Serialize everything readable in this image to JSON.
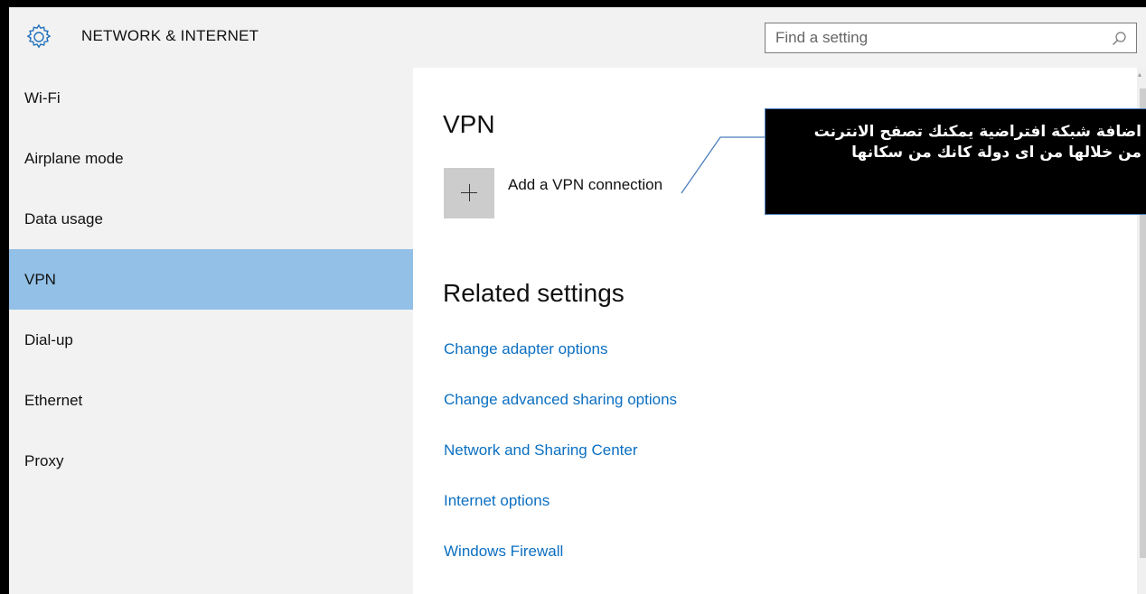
{
  "header": {
    "title": "NETWORK & INTERNET",
    "search_placeholder": "Find a setting"
  },
  "sidebar": {
    "items": [
      {
        "label": "Wi-Fi"
      },
      {
        "label": "Airplane mode"
      },
      {
        "label": "Data usage"
      },
      {
        "label": "VPN",
        "selected": true
      },
      {
        "label": "Dial-up"
      },
      {
        "label": "Ethernet"
      },
      {
        "label": "Proxy"
      }
    ]
  },
  "main": {
    "vpn_heading": "VPN",
    "add_vpn_label": "Add a VPN connection",
    "related_heading": "Related settings",
    "related_links": [
      {
        "label": "Change adapter options"
      },
      {
        "label": "Change advanced sharing options"
      },
      {
        "label": "Network and Sharing Center"
      },
      {
        "label": "Internet options"
      },
      {
        "label": "Windows Firewall"
      }
    ]
  },
  "callout": {
    "line1": "اضافة شبكة افتراضية يمكنك تصفح الانترنت",
    "line2": "من خلالها من اى دولة كانك من سكانها"
  },
  "colors": {
    "accent_selected": "#93c0e6",
    "link": "#0b6fc1",
    "header_bg": "#f2f2f2"
  }
}
